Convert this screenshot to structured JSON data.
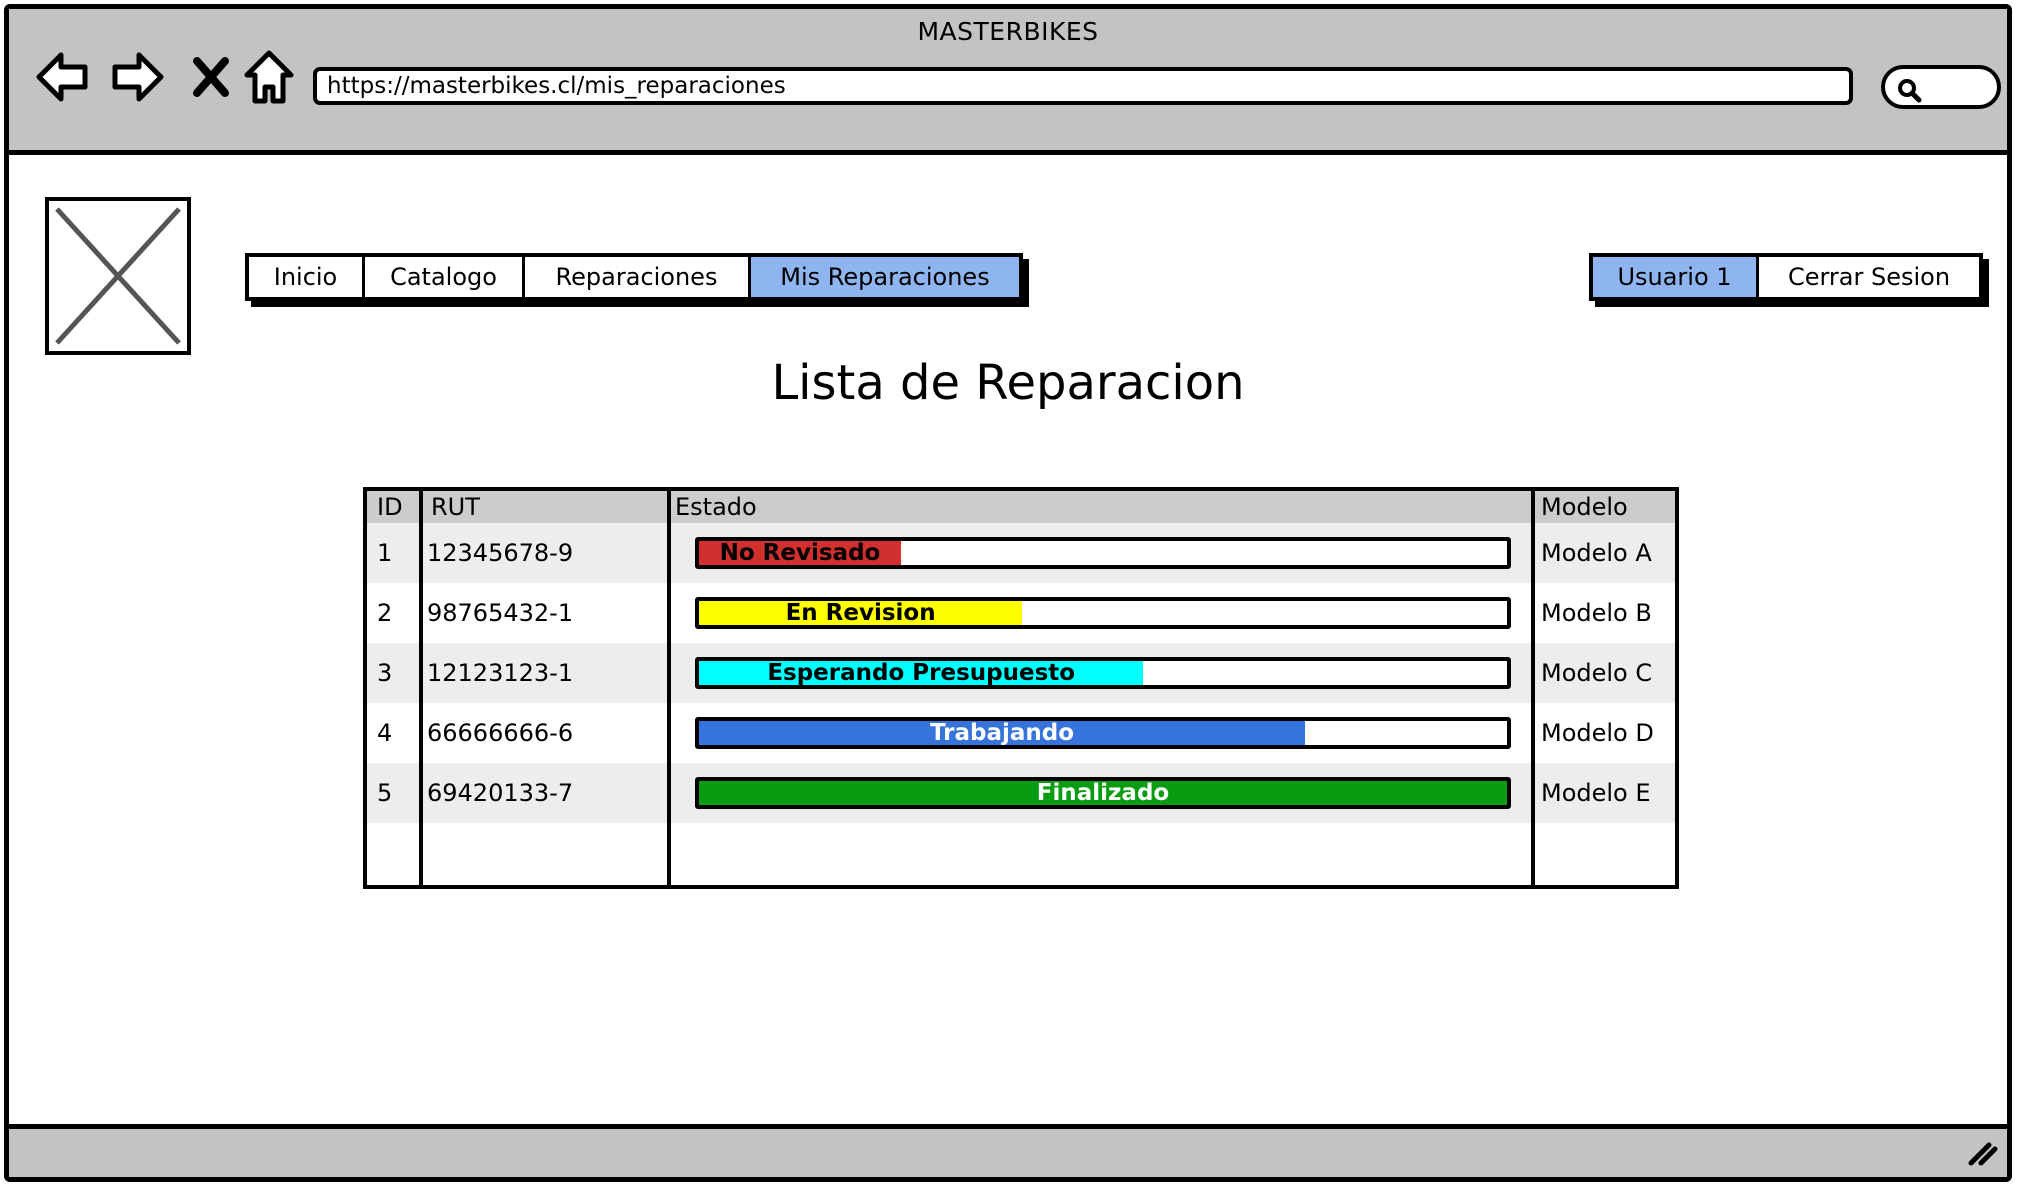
{
  "window": {
    "title": "MASTERBIKES"
  },
  "browser": {
    "url": "https://masterbikes.cl/mis_reparaciones",
    "icons": [
      "back-arrow-icon",
      "forward-arrow-icon",
      "close-x-icon",
      "home-icon",
      "search-icon"
    ]
  },
  "nav": {
    "tabs": [
      {
        "label": "Inicio"
      },
      {
        "label": "Catalogo"
      },
      {
        "label": "Reparaciones"
      },
      {
        "label": "Mis Reparaciones",
        "active": true
      }
    ]
  },
  "user": {
    "tabs": [
      {
        "label": "Usuario 1",
        "active": true
      },
      {
        "label": "Cerrar Sesion"
      }
    ]
  },
  "page": {
    "title": "Lista de Reparacion"
  },
  "table": {
    "headers": {
      "id": "ID",
      "rut": "RUT",
      "estado": "Estado",
      "modelo": "Modelo"
    },
    "rows": [
      {
        "id": "1",
        "rut": "12345678-9",
        "estado": "No Revisado",
        "progress": 0.25,
        "color": "#d22f2f",
        "text_color": "#000000",
        "modelo": "Modelo A"
      },
      {
        "id": "2",
        "rut": "98765432-1",
        "estado": "En Revision",
        "progress": 0.4,
        "color": "#ffff00",
        "text_color": "#000000",
        "modelo": "Modelo B"
      },
      {
        "id": "3",
        "rut": "12123123-1",
        "estado": "Esperando Presupuesto",
        "progress": 0.55,
        "color": "#00ffff",
        "text_color": "#000000",
        "modelo": "Modelo C"
      },
      {
        "id": "4",
        "rut": "66666666-6",
        "estado": "Trabajando",
        "progress": 0.75,
        "color": "#3674dc",
        "text_color": "#ffffff",
        "modelo": "Modelo D"
      },
      {
        "id": "5",
        "rut": "69420133-7",
        "estado": "Finalizado",
        "progress": 1.0,
        "color": "#089c10",
        "text_color": "#ffffff",
        "modelo": "Modelo E"
      }
    ]
  }
}
